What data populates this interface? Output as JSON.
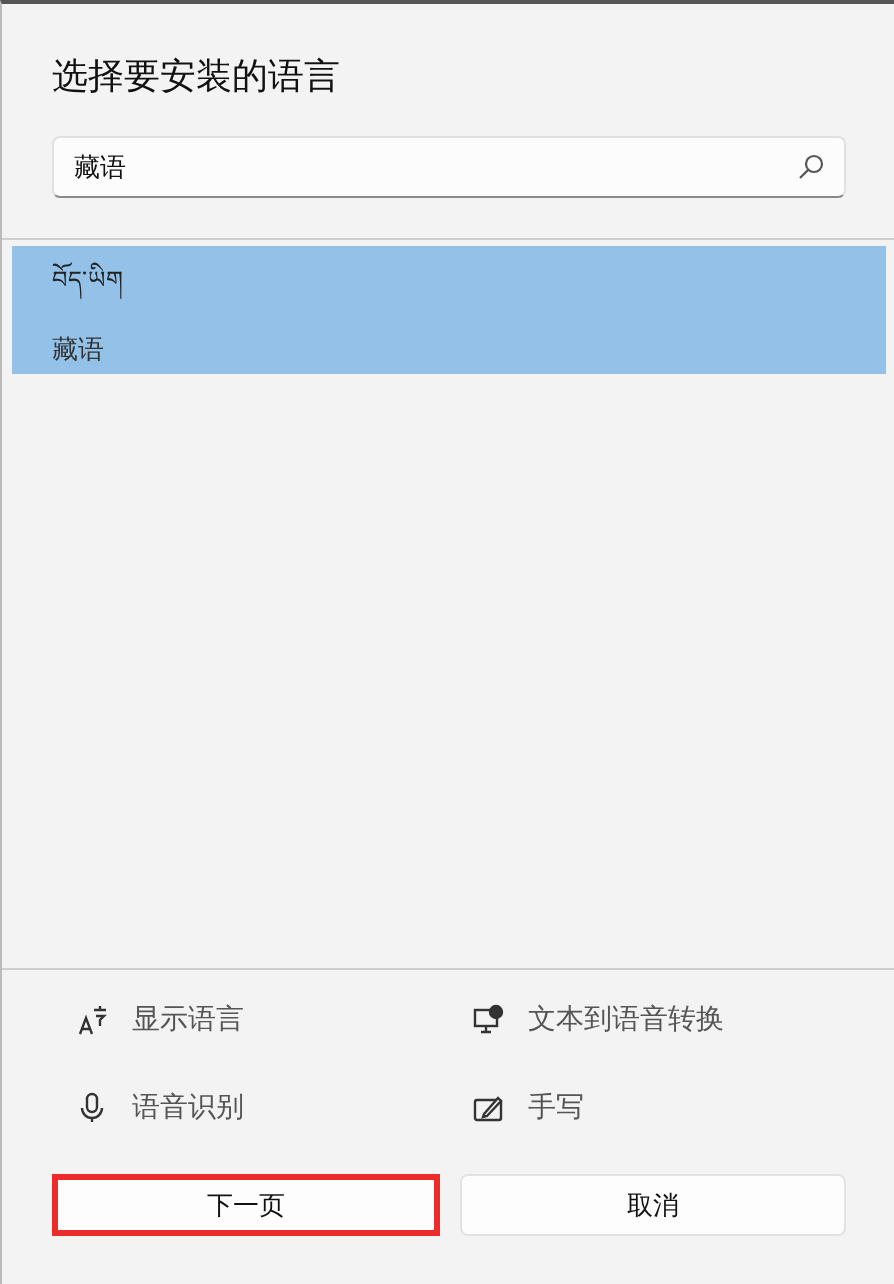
{
  "title": "选择要安装的语言",
  "search": {
    "value": "藏语"
  },
  "languages": [
    {
      "native_name": "བོད་ཡིག",
      "name": "藏语",
      "selected": true
    }
  ],
  "features": [
    {
      "kind": "display",
      "label": "显示语言"
    },
    {
      "kind": "tts",
      "label": "文本到语音转换"
    },
    {
      "kind": "speech",
      "label": "语音识别"
    },
    {
      "kind": "handwriting",
      "label": "手写"
    }
  ],
  "buttons": [
    {
      "label": "下一页",
      "highlighted": true
    },
    {
      "label": "取消",
      "highlighted": false
    }
  ]
}
